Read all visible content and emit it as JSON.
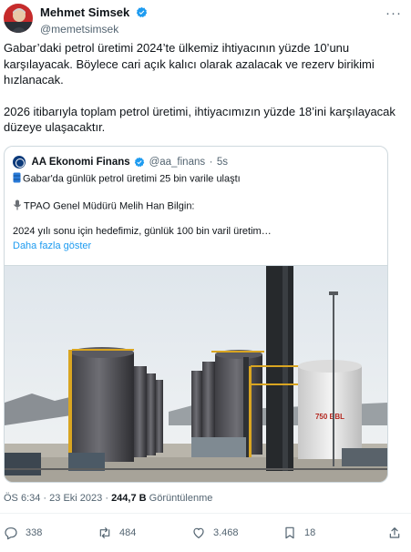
{
  "author": {
    "name": "Mehmet Simsek",
    "handle": "@memetsimsek"
  },
  "tweet": {
    "paragraphs": [
      "Gabar’daki petrol üretimi 2024’te ülkemiz ihtiyacının yüzde 10’unu karşılayacak. Böylece cari açık kalıcı olarak azalacak ve rezerv birikimi hızlanacak.",
      "2026 itibarıyla toplam petrol üretimi, ihtiyacımızın yüzde 18’ini karşılayacak düzeye ulaşacaktır."
    ]
  },
  "quote": {
    "name": "AA Ekonomi Finans",
    "handle": "@aa_finans",
    "separator": "·",
    "time": "5s",
    "line1": "Gabar'da günlük petrol üretimi 25 bin varile ulaştı",
    "line2": "TPAO Genel Müdürü Melih Han Bilgin:",
    "line3": "2024 yılı sonu için hedefimiz, günlük 100 bin varil üretim…",
    "show_more": "Daha fazla göster",
    "tank_label": "750 BBL"
  },
  "meta": {
    "time": "ÖS 6:34",
    "dot": "·",
    "date": "23 Eki 2023",
    "views_count": "244,7 B",
    "views_label": "Görüntülenme"
  },
  "actions": {
    "replies": "338",
    "retweets": "484",
    "likes": "3.468",
    "bookmarks": "18"
  },
  "colors": {
    "accent": "#1d9bf0",
    "text": "#0f1419",
    "muted": "#536471",
    "border": "#cfd9de"
  }
}
